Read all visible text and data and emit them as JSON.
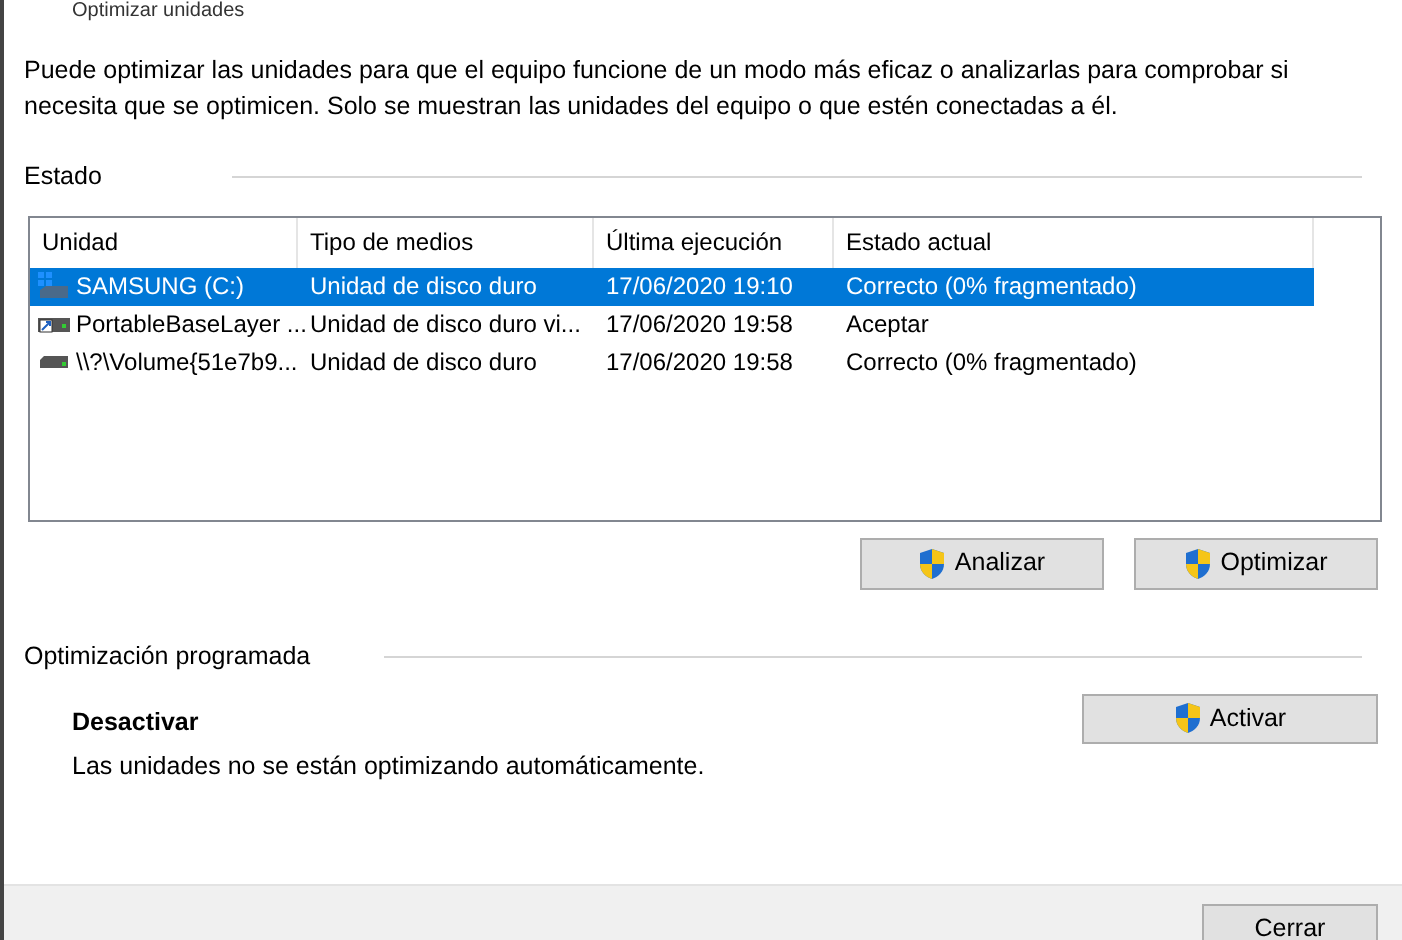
{
  "window": {
    "title": "Optimizar unidades"
  },
  "description": "Puede optimizar las unidades para que el equipo funcione de un modo más eficaz o analizarlas para comprobar si necesita que se optimicen. Solo se muestran las unidades del equipo o que estén conectadas a él.",
  "status": {
    "heading": "Estado",
    "table": {
      "columns": [
        "Unidad",
        "Tipo de medios",
        "Última ejecución",
        "Estado actual"
      ],
      "rows": [
        {
          "kind": "system",
          "selected": true,
          "cells": [
            "SAMSUNG (C:)",
            "Unidad de disco duro",
            "17/06/2020 19:10",
            "Correcto (0% fragmentado)"
          ]
        },
        {
          "kind": "virtual",
          "selected": false,
          "cells": [
            "PortableBaseLayer ...",
            "Unidad de disco duro vi...",
            "17/06/2020 19:58",
            "Aceptar"
          ]
        },
        {
          "kind": "disk",
          "selected": false,
          "cells": [
            "\\\\?\\Volume{51e7b9...",
            "Unidad de disco duro",
            "17/06/2020 19:58",
            "Correcto (0% fragmentado)"
          ]
        }
      ]
    },
    "buttons": [
      "Analizar",
      "Optimizar"
    ]
  },
  "schedule": {
    "heading": "Optimización programada",
    "state": "Desactivar",
    "note": "Las unidades no se están optimizando automáticamente.",
    "button": "Activar"
  },
  "footer": {
    "button": "Cerrar"
  }
}
